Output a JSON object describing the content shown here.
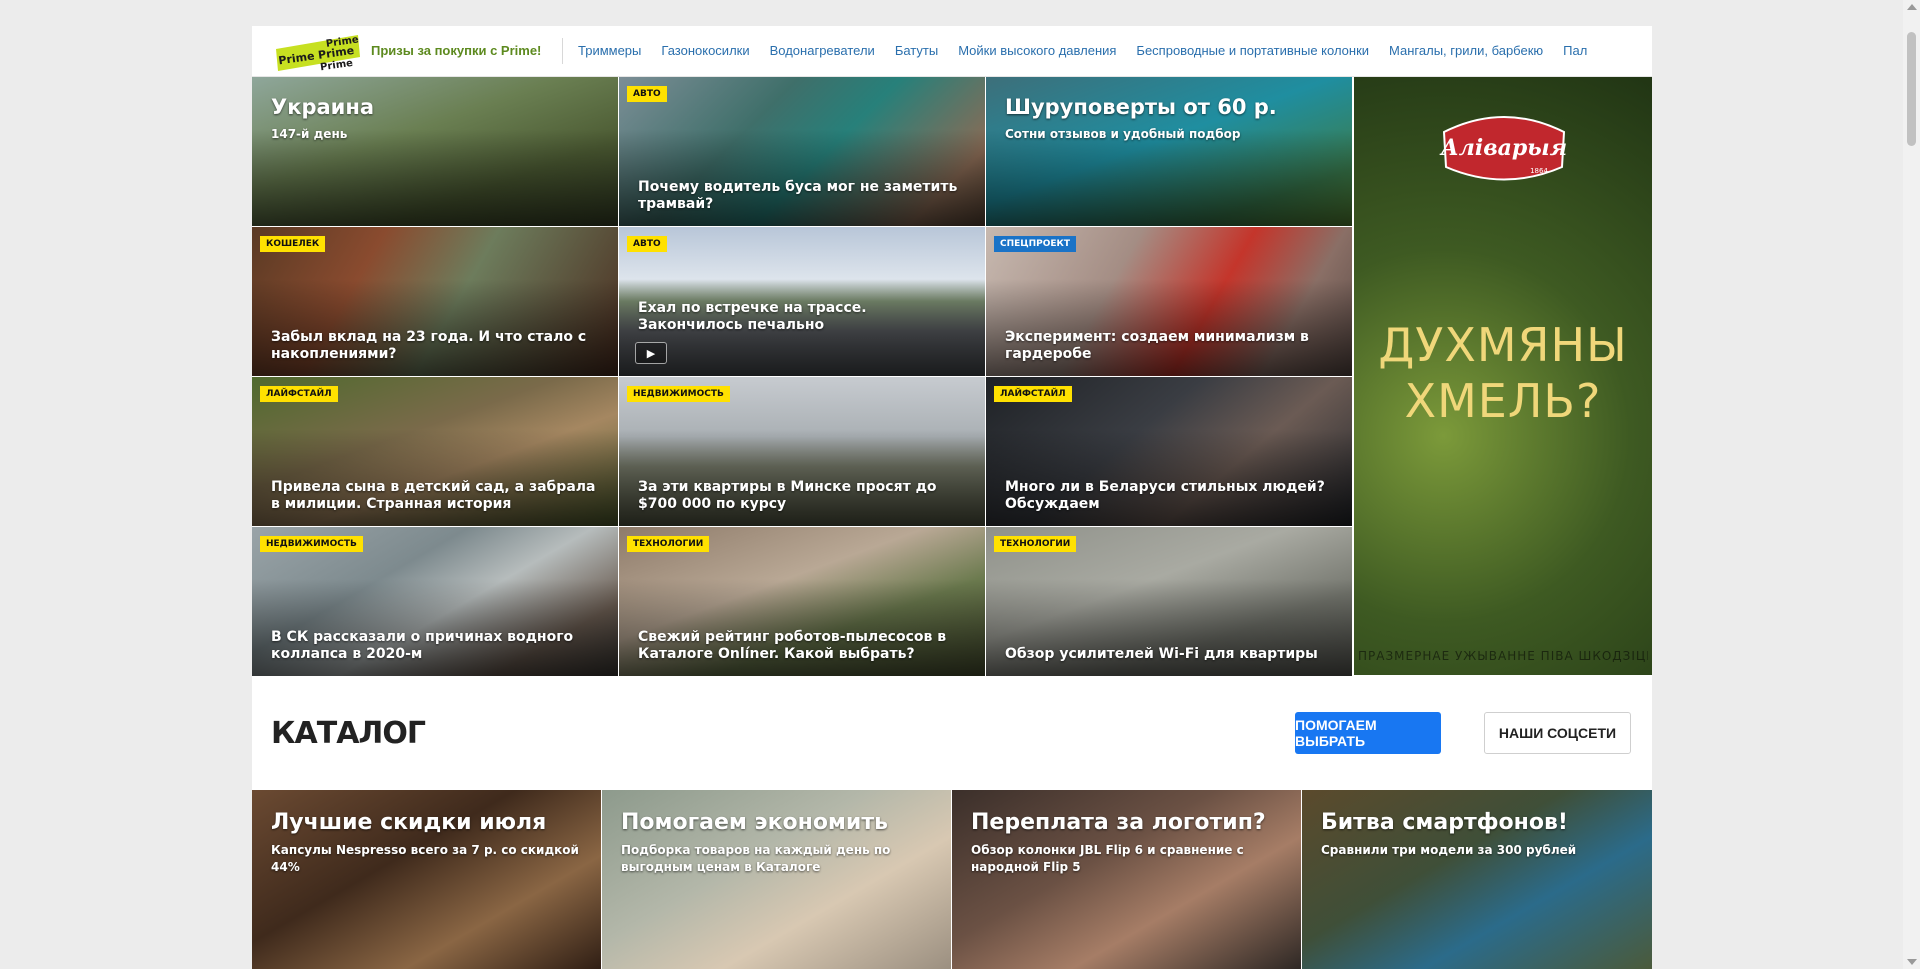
{
  "topbar": {
    "logo_words": "Prime Prime Prime",
    "prime_link": "Призы за покупки с Prime!",
    "nav": [
      "Триммеры",
      "Газонокосилки",
      "Водонагреватели",
      "Батуты",
      "Мойки высокого давления",
      "Беспроводные и портативные колонки",
      "Мангалы, грили, барбекю",
      "Пал"
    ]
  },
  "news": [
    {
      "title": "Украина",
      "subtitle": "147-й день",
      "tag": "",
      "tag_style": ""
    },
    {
      "title": "Почему водитель буса мог не заметить трамвай?",
      "tag": "АВТО",
      "tag_style": "yellow"
    },
    {
      "title": "Шуруповерты от 60 р.",
      "subtitle": "Сотни отзывов и удобный подбор",
      "tag": "",
      "tag_style": ""
    },
    {
      "title": "Забыл вклад на 23 года. И что стало с накоплениями?",
      "tag": "КОШЕЛЕК",
      "tag_style": "yellow"
    },
    {
      "title": "Ехал по встречке на трассе. Закончилось печально",
      "tag": "АВТО",
      "tag_style": "yellow",
      "video_icon": "video-camera-icon"
    },
    {
      "title": "Эксперимент: создаем минимализм в гардеробе",
      "tag": "СПЕЦПРОЕКТ",
      "tag_style": "blue"
    },
    {
      "title": "Привела сына в детский сад, а забрала в милиции. Странная история",
      "tag": "ЛАЙФСТАЙЛ",
      "tag_style": "yellow"
    },
    {
      "title": "За эти квартиры в Минске просят до $700 000 по курсу",
      "tag": "НЕДВИЖИМОСТЬ",
      "tag_style": "yellow"
    },
    {
      "title": "Много ли в Беларуси стильных людей? Обсуждаем",
      "tag": "ЛАЙФСТАЙЛ",
      "tag_style": "yellow"
    },
    {
      "title": "В СК рассказали о причинах водного коллапса в 2020-м",
      "tag": "НЕДВИЖИМОСТЬ",
      "tag_style": "yellow"
    },
    {
      "title": "Свежий рейтинг роботов-пылесосов в Каталоге Onlíner. Какой выбрать?",
      "tag": "ТЕХНОЛОГИИ",
      "tag_style": "yellow"
    },
    {
      "title": "Обзор усилителей Wi-Fi для квартиры",
      "tag": "ТЕХНОЛОГИИ",
      "tag_style": "yellow"
    }
  ],
  "ad": {
    "brand": "Аліварыя",
    "year": "1864",
    "slogan_line1": "ДУХМЯНЫ",
    "slogan_line2": "ХМЕЛЬ?",
    "fine_print": "ПРАЗМЕРНАЕ УЖЫВАННЕ ПІВА ШКОДЗІЦЬ ВАШАМУ ЗДАРОЎЮ"
  },
  "catalog": {
    "title": "КАТАЛОГ",
    "btn_help": "ПОМОГАЕМ ВЫБРАТЬ",
    "btn_social": "НАШИ СОЦСЕТИ",
    "items": [
      {
        "title": "Лучшие скидки июля",
        "subtitle": "Капсулы Nespresso всего за 7 р. со скидкой 44%"
      },
      {
        "title": "Помогаем экономить",
        "subtitle": "Подборка товаров на каждый день по выгодным ценам в Каталоге"
      },
      {
        "title": "Переплата за логотип?",
        "subtitle": "Обзор колонки JBL Flip 6 и сравнение с народной Flip 5"
      },
      {
        "title": "Битва смартфонов!",
        "subtitle": "Сравнили три модели за 300 рублей"
      }
    ]
  },
  "colors": {
    "accent": "#1877f2",
    "tag_yellow": "#ffe100",
    "tag_blue": "#1a73c7",
    "prime_green": "#5d8a1f",
    "link_blue": "#2a6fad"
  }
}
